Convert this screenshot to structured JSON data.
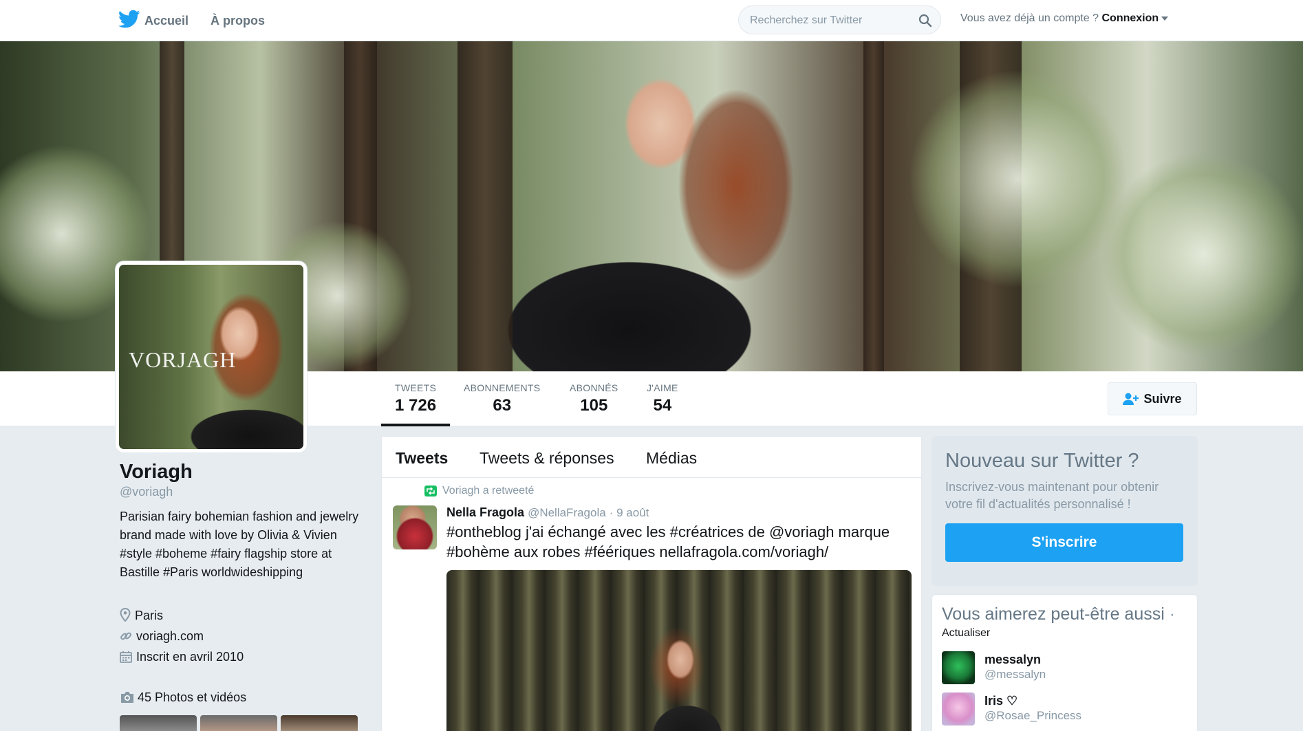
{
  "topbar": {
    "home_label": "Accueil",
    "about_label": "À propos",
    "search_placeholder": "Recherchez sur Twitter",
    "account_prompt": "Vous avez déjà un compte ?",
    "login_label": "Connexion"
  },
  "stats": [
    {
      "label": "TWEETS",
      "value": "1 726"
    },
    {
      "label": "ABONNEMENTS",
      "value": "63"
    },
    {
      "label": "ABONNÉS",
      "value": "105"
    },
    {
      "label": "J'AIME",
      "value": "54"
    }
  ],
  "follow_label": "Suivre",
  "profile": {
    "avatar_wordmark": "VORJAGH",
    "name": "Voriagh",
    "handle": "@voriagh",
    "bio": "Parisian fairy bohemian fashion and jewelry brand made with love by Olivia & Vivien #style #boheme #fairy flagship store at Bastille #Paris worldwideshipping",
    "location": "Paris",
    "website": "voriagh.com",
    "joined": "Inscrit en avril 2010",
    "photos_label": "45 Photos et vidéos"
  },
  "timeline": {
    "tabs": [
      "Tweets",
      "Tweets & réponses",
      "Médias"
    ],
    "retweet_label": "Voriagh a retweeté",
    "tweet": {
      "author_name": "Nella Fragola",
      "author_handle": "@NellaFragola",
      "date": "· 9 août",
      "text": "#ontheblog j'ai échangé avec les #créatrices de @voriagh marque #bohème aux robes #féériques nellafragola.com/voriagh/"
    }
  },
  "signup": {
    "title": "Nouveau sur Twitter ?",
    "text": "Inscrivez-vous maintenant pour obtenir votre fil d'actualités personnalisé !",
    "button": "S'inscrire"
  },
  "suggestions": {
    "title": "Vous aimerez peut-être aussi",
    "dot": "·",
    "refresh": "Actualiser",
    "users": [
      {
        "name": "messalyn",
        "handle": "@messalyn"
      },
      {
        "name": "Iris ♡",
        "handle": "@Rosae_Princess"
      }
    ]
  },
  "colors": {
    "accent": "#1da1f2",
    "retweet": "#17bf63",
    "muted": "#8899a6"
  },
  "icons": [
    "twitter-bird-icon",
    "search-icon",
    "add-user-icon",
    "retweet-icon",
    "location-icon",
    "link-icon",
    "calendar-icon",
    "camera-icon"
  ]
}
